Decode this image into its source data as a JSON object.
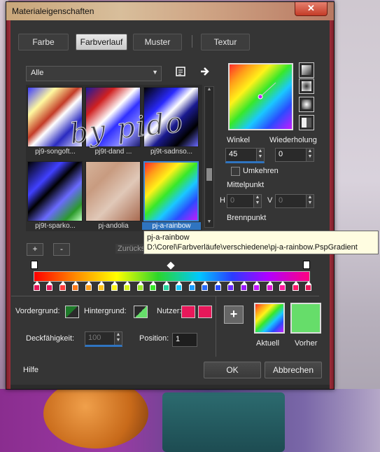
{
  "window": {
    "title": "Materialeigenschaften",
    "close_glyph": "✕"
  },
  "tabs": [
    {
      "label": "Farbe",
      "active": false
    },
    {
      "label": "Farbverlauf",
      "active": true
    },
    {
      "label": "Muster",
      "active": false
    },
    {
      "label": "Textur",
      "active": false
    }
  ],
  "category": {
    "selected": "Alle"
  },
  "gallery": {
    "items": [
      {
        "label": "pj9-songoft...",
        "selected": false
      },
      {
        "label": "pj9t-dand ...",
        "selected": false
      },
      {
        "label": "pj9t-sadnso...",
        "selected": false
      },
      {
        "label": "pj9t-sparko...",
        "selected": false
      },
      {
        "label": "pj-andolia",
        "selected": false
      },
      {
        "label": "pj-a-rainbow",
        "selected": true
      }
    ],
    "watermark": "by pido"
  },
  "buttons": {
    "add": "+",
    "remove": "-",
    "reset": "Zurückse",
    "help": "Hilfe",
    "ok": "OK",
    "cancel": "Abbrechen"
  },
  "style": {
    "winkel_label": "Winkel",
    "winkel_value": "45",
    "wiederholung_label": "Wiederholung",
    "wiederholung_value": "0",
    "umkehren_label": "Umkehren",
    "mittelpunkt_label": "Mittelpunkt",
    "h_label": "H",
    "h_value": "0",
    "v_label": "V",
    "v_value": "0",
    "brennpunkt_label": "Brennpunkt"
  },
  "tooltip": {
    "name": "pj-a-rainbow",
    "path": "D:\\Corel\\Farbverläufe\\verschiedene\\pj-a-rainbow.PspGradient"
  },
  "editor": {
    "vordergrund_label": "Vordergrund:",
    "hintergrund_label": "Hintergrund:",
    "nutzer_label": "Nutzer:",
    "nutzer_color": "#e8185a",
    "deckfaehigkeit_label": "Deckfähigkeit:",
    "deckfaehigkeit_value": "100",
    "position_label": "Position:",
    "position_value": "1",
    "aktuell_label": "Aktuell",
    "vorher_label": "Vorher",
    "vorher_color": "#66dd6a"
  },
  "stop_colors": [
    "#e8185a",
    "#e8185a",
    "#ff3b3b",
    "#ff7a1a",
    "#ff9c1a",
    "#ffc21a",
    "#fff21a",
    "#d6f21a",
    "#9ae82a",
    "#38e82a",
    "#2ad6a0",
    "#1ac8ff",
    "#1a9cff",
    "#2a6cff",
    "#2a4cff",
    "#6a2aff",
    "#9a1aff",
    "#c41aff",
    "#e01ad6",
    "#ff1a9c",
    "#ff1a6a",
    "#e8185a"
  ],
  "icons": [
    "clipboard-icon",
    "arrow-right-icon",
    "close-icon",
    "plus-icon",
    "chevron-down-icon"
  ]
}
